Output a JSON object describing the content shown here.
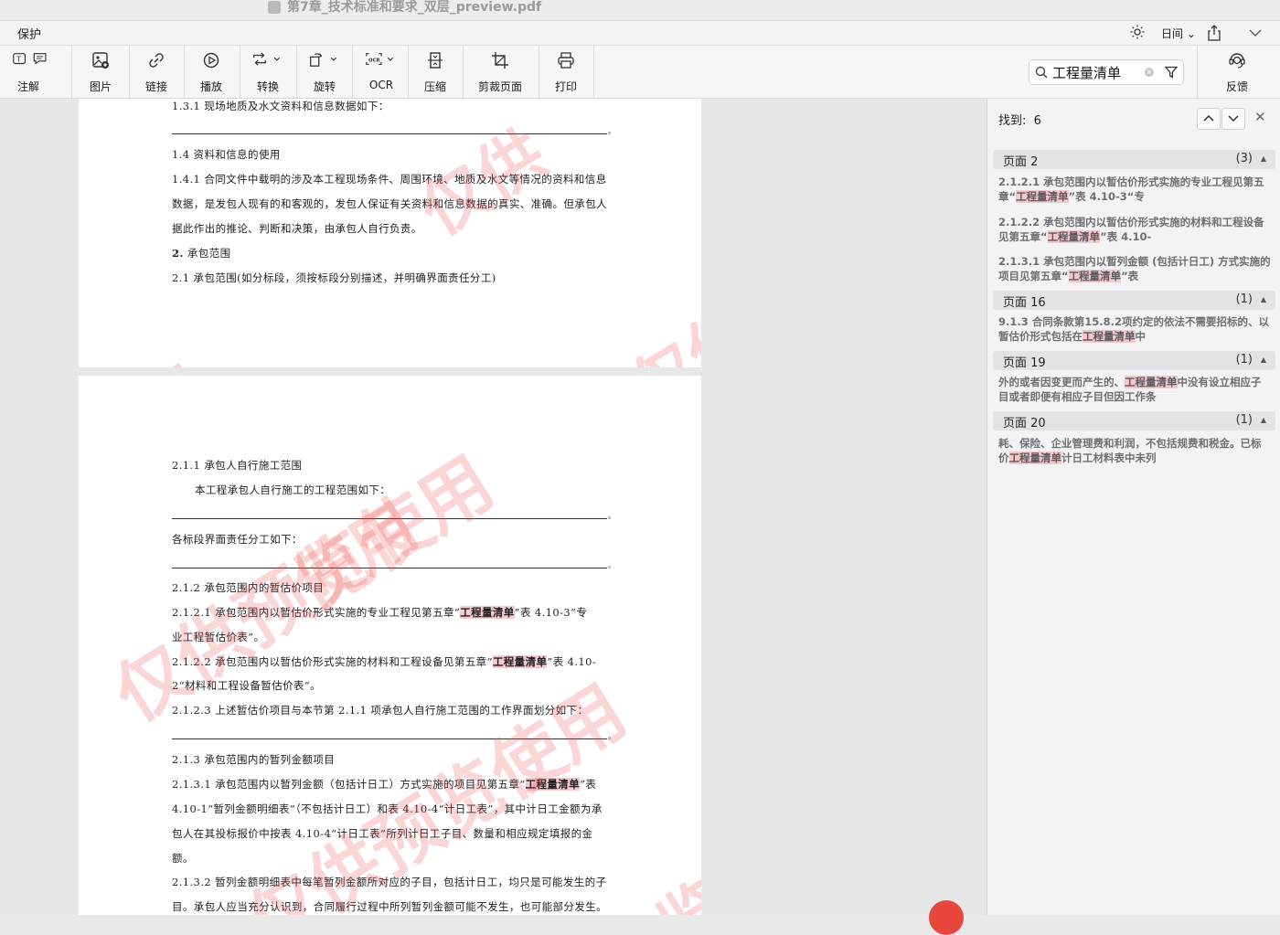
{
  "window": {
    "title": "第7章_技术标准和要求_双层_preview.pdf"
  },
  "menubar": {
    "protect_label": "保护",
    "day_mode_label": "日间",
    "icons": [
      "sun-icon",
      "share-icon",
      "chevron-down-icon"
    ]
  },
  "toolbar": {
    "items": [
      {
        "label": "注解",
        "icon": "annotate-icon"
      },
      {
        "label": "图片",
        "icon": "image-icon"
      },
      {
        "label": "链接",
        "icon": "link-icon"
      },
      {
        "label": "播放",
        "icon": "play-icon"
      },
      {
        "label": "转换",
        "icon": "convert-icon"
      },
      {
        "label": "旋转",
        "icon": "rotate-icon"
      },
      {
        "label": "OCR",
        "icon": "ocr-icon"
      },
      {
        "label": "压缩",
        "icon": "compress-icon"
      },
      {
        "label": "剪裁页面",
        "icon": "crop-icon"
      },
      {
        "label": "打印",
        "icon": "print-icon"
      },
      {
        "label": "反馈",
        "icon": "feedback-icon"
      }
    ]
  },
  "search": {
    "query": "工程量清单",
    "found_label": "找到:",
    "found_count": "6"
  },
  "results": [
    {
      "page": "页面 2",
      "count": "(3)",
      "items": [
        {
          "pre": "2.1.2.1 承包范围内以暂估价形式实施的专业工程见第五章“",
          "hit": "工程量清单",
          "post": "”表 4.10-3“专"
        },
        {
          "pre": "2.1.2.2 承包范围内以暂估价形式实施的材料和工程设备见第五章“",
          "hit": "工程量清单",
          "post": "”表 4.10-"
        },
        {
          "pre": "2.1.3.1 承包范围内以暂列金额 (包括计日工) 方式实施的项目见第五章“",
          "hit": "工程量清单",
          "post": "”表"
        }
      ]
    },
    {
      "page": "页面 16",
      "count": "(1)",
      "items": [
        {
          "pre": "9.1.3 合同条款第15.8.2项约定的依法不需要招标的、以暂估价形式包括在",
          "hit": "工程量清单",
          "post": "中"
        }
      ]
    },
    {
      "page": "页面 19",
      "count": "(1)",
      "items": [
        {
          "pre": "外的或者因变更而产生的、",
          "hit": "工程量清单",
          "post": "中没有设立相应子目或者即便有相应子目但因工作条"
        }
      ]
    },
    {
      "page": "页面 20",
      "count": "(1)",
      "items": [
        {
          "pre": "耗、保险、企业管理费和利润，不包括规费和税金。已标价",
          "hit": "工程量清单",
          "post": "计日工材料表中未列"
        }
      ]
    }
  ],
  "document": {
    "page_a": {
      "l1": "1.3.1 现场地质及水文资料和信息数据如下：",
      "l2": "1.4 资料和信息的使用",
      "l3": "1.4.1 合同文件中载明的涉及本工程现场条件、周围环境、地质及水文等情况的资料和信息",
      "l4": "数据，是发包人现有的和客观的，发包人保证有关资料和信息数据的真实、准确。但承包人",
      "l5": "据此作出的推论、判断和决策，由承包人自行负责。",
      "l6_num": "2.",
      "l6_text": " 承包范围",
      "l7": "2.1 承包范围(如分标段，须按标段分别描述，并明确界面责任分工)"
    },
    "page_b": {
      "l1": "2.1.1 承包人自行施工范围",
      "l2": "本工程承包人自行施工的工程范围如下：",
      "l3": "各标段界面责任分工如下：",
      "l4": "2.1.2 承包范围内的暂估价项目",
      "l5_pre": "2.1.2.1 承包范围内以暂估价形式实施的专业工程见第五章“",
      "l5_hit": "工程量清单",
      "l5_post": "”表 4.10-3“专",
      "l6": "业工程暂估价表”。",
      "l7_pre": "2.1.2.2 承包范围内以暂估价形式实施的材料和工程设备见第五章“",
      "l7_hit": "工程量清单",
      "l7_post": "”表 4.10-",
      "l8": "2“材料和工程设备暂估价表”。",
      "l9": "2.1.2.3 上述暂估价项目与本节第 2.1.1 项承包人自行施工范围的工作界面划分如下：",
      "l10": "2.1.3 承包范围内的暂列金额项目",
      "l11_pre": "2.1.3.1 承包范围内以暂列金额（包括计日工）方式实施的项目见第五章“",
      "l11_hit": "工程量清单",
      "l11_post": "”表",
      "l12": "4.10-1“暂列金额明细表”（不包括计日工）和表 4.10-4“计日工表”，其中计日工金额为承",
      "l13": "包人在其投标报价中按表 4.10-4“计日工表”所列计日工子目、数量和相应规定填报的金",
      "l14": "额。",
      "l15": "2.1.3.2 暂列金额明细表中每笔暂列金额所对应的子目，包括计日工，均只是可能发生的子",
      "l16": "目。承包人应当充分认识到，合同履行过程中所列暂列金额可能不发生，也可能部分发生。"
    },
    "watermark_text": "仅供预览使用",
    "watermark_fragments": [
      "仅供",
      "用",
      "仅供",
      "览",
      "使用"
    ],
    "line_end_marker": "。"
  },
  "colors": {
    "highlight": "#f7c9cc",
    "watermark": "#e64646",
    "accent_red": "#e8453c"
  }
}
